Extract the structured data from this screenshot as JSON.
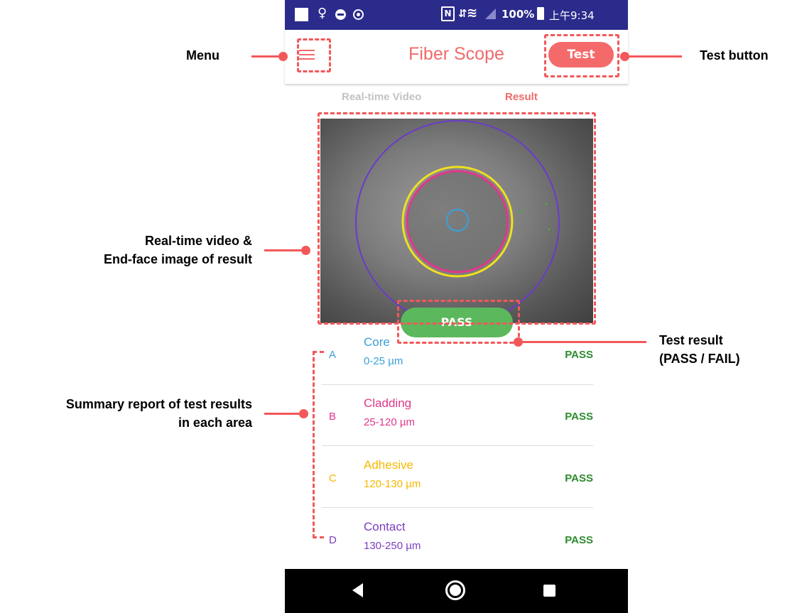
{
  "status_bar": {
    "battery": "100%",
    "time": "上午9:34",
    "nfc": "N"
  },
  "app": {
    "title": "Fiber Scope",
    "test_button": "Test"
  },
  "tabs": [
    {
      "label": "Real-time Video",
      "active": false
    },
    {
      "label": "Result",
      "active": true
    }
  ],
  "result": {
    "badge": "PASS"
  },
  "areas": [
    {
      "letter": "A",
      "name": "Core",
      "range": "0-25 µm",
      "status": "PASS",
      "color": "#3aa0d8"
    },
    {
      "letter": "B",
      "name": "Cladding",
      "range": "25-120 µm",
      "status": "PASS",
      "color": "#e0388a"
    },
    {
      "letter": "C",
      "name": "Adhesive",
      "range": "120-130 µm",
      "status": "PASS",
      "color": "#f5b800"
    },
    {
      "letter": "D",
      "name": "Contact",
      "range": "130-250 µm",
      "status": "PASS",
      "color": "#7a3fc0"
    }
  ],
  "annotations": {
    "menu": "Menu",
    "test_button": "Test button",
    "video_line1": "Real-time video &",
    "video_line2": "End-face image of result",
    "result_line1": "Test result",
    "result_line2": "(PASS / FAIL)",
    "summary_line1": "Summary report of test results",
    "summary_line2": "in each area"
  },
  "colors": {
    "accent": "#f06a6a",
    "pass": "#5cb85c",
    "annotation": "#f2585a",
    "status_bar": "#2b2b8c"
  },
  "icons": {
    "menu": "hamburger-icon",
    "back": "back-triangle-icon",
    "home": "home-circle-icon",
    "recent": "recent-square-icon"
  }
}
